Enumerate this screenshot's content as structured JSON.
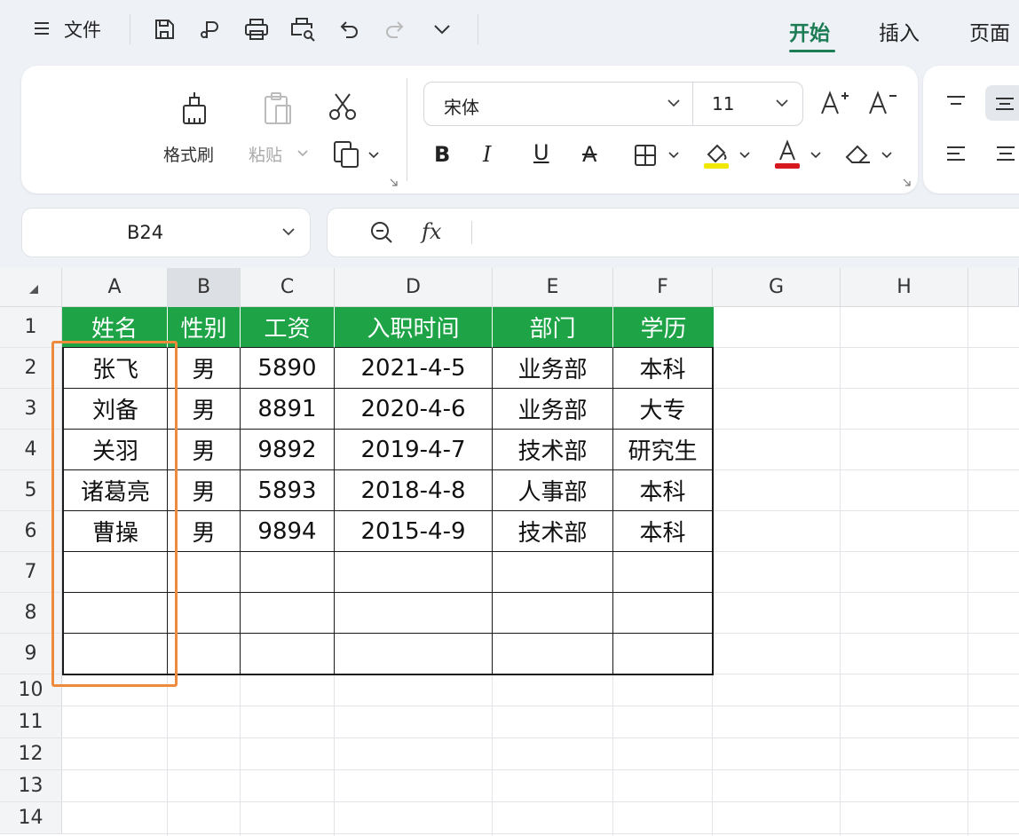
{
  "menu": {
    "icon": "hamburger-menu-icon",
    "label": "文件"
  },
  "quick_toolbar": [
    "save-icon",
    "export-pdf-icon",
    "print-icon",
    "print-preview-icon",
    "undo-icon",
    "redo-icon",
    "more-dropdown-icon"
  ],
  "tabs": [
    {
      "label": "开始",
      "active": true
    },
    {
      "label": "插入",
      "active": false
    },
    {
      "label": "页面",
      "active": false
    }
  ],
  "ribbon": {
    "format_painter_label": "格式刷",
    "paste_label": "粘贴",
    "font_name": "宋体",
    "font_size": "11",
    "bold": "B",
    "italic": "I",
    "underline": "U",
    "strike": "A",
    "font_color_hex": "#d7181f",
    "highlight_color_hex": "#f0e800"
  },
  "formula_bar": {
    "cell_ref": "B24",
    "fx": "fx",
    "value": ""
  },
  "accent_color": "#1ea447",
  "highlight_border_color": "#ee8a3c",
  "columns": [
    "A",
    "B",
    "C",
    "D",
    "E",
    "F",
    "G",
    "H"
  ],
  "selected_column": "B",
  "rows": [
    "1",
    "2",
    "3",
    "4",
    "5",
    "6",
    "7",
    "8",
    "9",
    "10",
    "11",
    "12",
    "13",
    "14"
  ],
  "table": {
    "headers": [
      "姓名",
      "性别",
      "工资",
      "入职时间",
      "部门",
      "学历"
    ],
    "rows": [
      [
        "张飞",
        "男",
        "5890",
        "2021-4-5",
        "业务部",
        "本科"
      ],
      [
        "刘备",
        "男",
        "8891",
        "2020-4-6",
        "业务部",
        "大专"
      ],
      [
        "关羽",
        "男",
        "9892",
        "2019-4-7",
        "技术部",
        "研究生"
      ],
      [
        "诸葛亮",
        "男",
        "5893",
        "2018-4-8",
        "人事部",
        "本科"
      ],
      [
        "曹操",
        "男",
        "9894",
        "2015-4-9",
        "技术部",
        "本科"
      ],
      [
        "",
        "",
        "",
        "",
        "",
        ""
      ],
      [
        "",
        "",
        "",
        "",
        "",
        ""
      ],
      [
        "",
        "",
        "",
        "",
        "",
        ""
      ]
    ]
  }
}
